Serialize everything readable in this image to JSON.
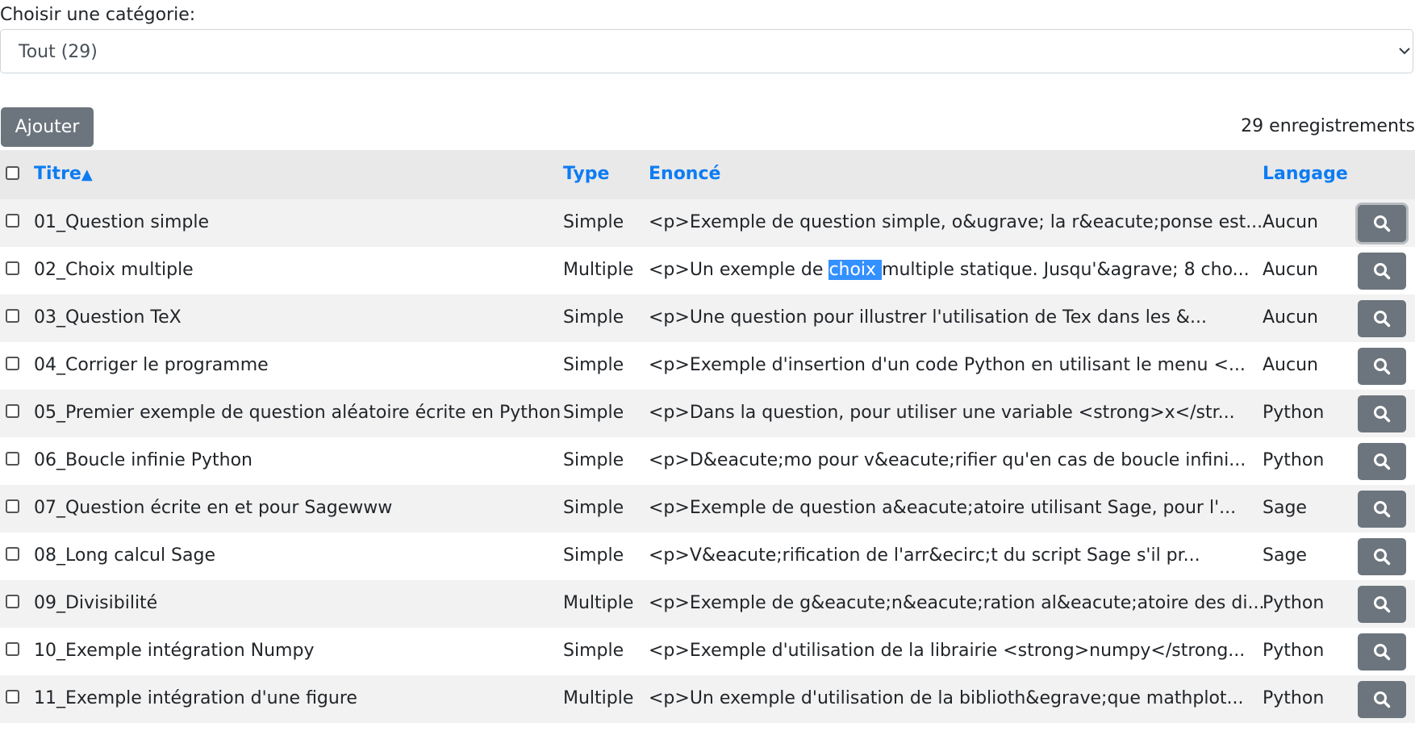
{
  "category": {
    "label": "Choisir une catégorie:",
    "selected": "Tout (29)"
  },
  "toolbar": {
    "add_label": "Ajouter",
    "record_count": "29 enregistrements"
  },
  "table": {
    "headers": {
      "title": "Titre",
      "sort_indicator": "▲",
      "type": "Type",
      "statement": "Enoncé",
      "language": "Langage"
    },
    "rows": [
      {
        "title": "01_Question simple",
        "type": "Simple",
        "statement": "<p>Exemple de question simple, o&ugrave; la r&eacute;ponse est...",
        "language": "Aucun"
      },
      {
        "title": "02_Choix multiple",
        "type": "Multiple",
        "statement": "<p>Un exemple de choix multiple statique. Jusqu'&agrave; 8 cho...",
        "statement_before": "<p>Un exemple de ",
        "statement_selected": "choix ",
        "statement_after": "multiple statique. Jusqu'&agrave; 8 cho...",
        "language": "Aucun"
      },
      {
        "title": "03_Question TeX",
        "type": "Simple",
        "statement": "<p>Une question pour illustrer l'utilisation de Tex dans les &...",
        "language": "Aucun"
      },
      {
        "title": "04_Corriger le programme",
        "type": "Simple",
        "statement": "<p>Exemple d'insertion d'un code Python en utilisant le menu <...",
        "language": "Aucun"
      },
      {
        "title": "05_Premier exemple de question aléatoire écrite en Python",
        "type": "Simple",
        "statement": "<p>Dans la question, pour utiliser une variable <strong>x</str...",
        "language": "Python"
      },
      {
        "title": "06_Boucle infinie Python",
        "type": "Simple",
        "statement": "<p>D&eacute;mo pour v&eacute;rifier qu'en cas de boucle infini...",
        "language": "Python"
      },
      {
        "title": "07_Question écrite en et pour Sagewww",
        "type": "Simple",
        "statement": "<p>Exemple de question a&eacute;atoire utilisant Sage, pour l'...",
        "language": "Sage"
      },
      {
        "title": "08_Long calcul Sage",
        "type": "Simple",
        "statement": "<p>V&eacute;rification de l'arr&ecirc;t du script Sage s'il pr...",
        "language": "Sage"
      },
      {
        "title": "09_Divisibilité",
        "type": "Multiple",
        "statement": "<p>Exemple de g&eacute;n&eacute;ration al&eacute;atoire des di...",
        "language": "Python"
      },
      {
        "title": "10_Exemple intégration Numpy",
        "type": "Simple",
        "statement": "<p>Exemple d'utilisation de la librairie <strong>numpy</strong...",
        "language": "Python"
      },
      {
        "title": "11_Exemple intégration d'une figure",
        "type": "Multiple",
        "statement": "<p>Un exemple d'utilisation de la biblioth&egrave;que mathplot...",
        "language": "Python"
      }
    ]
  },
  "icons": {
    "row_action": "search-icon",
    "select": "chevron-down-icon",
    "checkbox": "checkbox-icon"
  },
  "colors": {
    "link_blue": "#0d7cf2",
    "button_gray": "#6c757d",
    "selection": "#3390ff"
  }
}
